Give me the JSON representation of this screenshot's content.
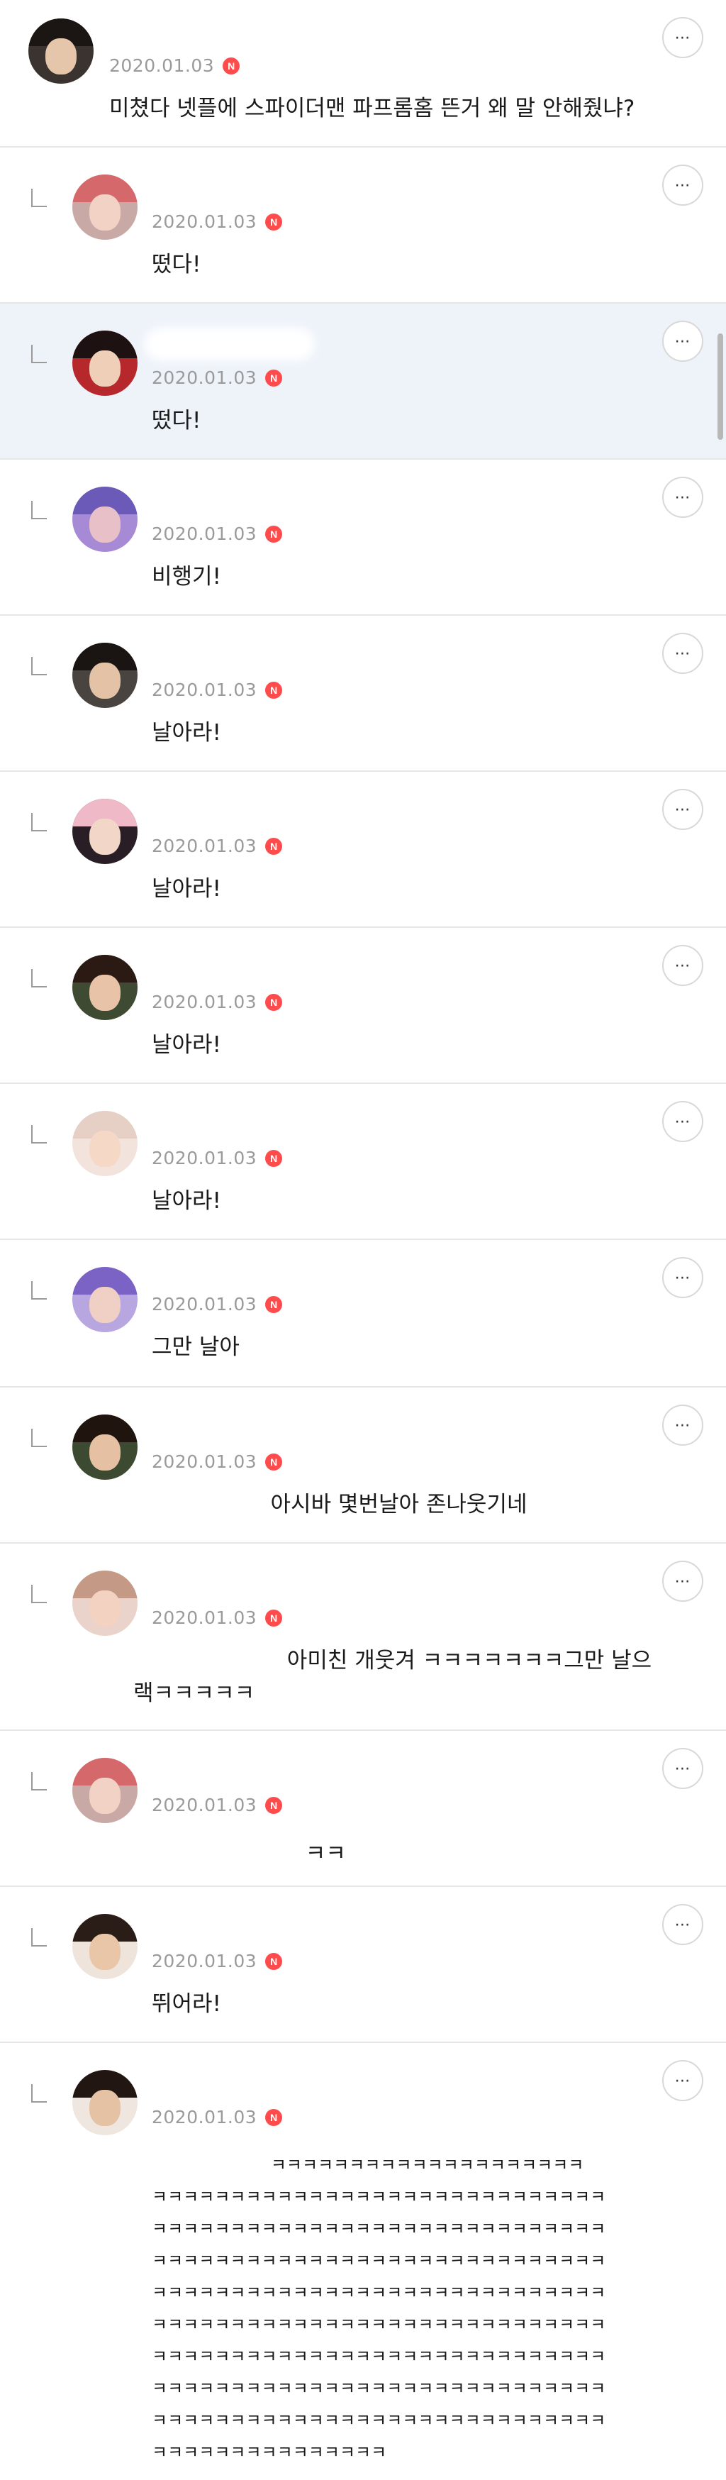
{
  "post": {
    "date": "2020.01.03",
    "badge": "N",
    "text": "미쳤다 넷플에 스파이더맨 파프롬홈 뜬거 왜 말 안해줬냐?",
    "more": "⋯"
  },
  "replies": [
    {
      "date": "2020.01.03",
      "badge": "N",
      "text": "떴다!",
      "more": "⋯"
    },
    {
      "date": "2020.01.03",
      "badge": "N",
      "text": "떴다!",
      "more": "⋯"
    },
    {
      "date": "2020.01.03",
      "badge": "N",
      "text": "비행기!",
      "more": "⋯"
    },
    {
      "date": "2020.01.03",
      "badge": "N",
      "text": "날아라!",
      "more": "⋯"
    },
    {
      "date": "2020.01.03",
      "badge": "N",
      "text": "날아라!",
      "more": "⋯"
    },
    {
      "date": "2020.01.03",
      "badge": "N",
      "text": "날아라!",
      "more": "⋯"
    },
    {
      "date": "2020.01.03",
      "badge": "N",
      "text": "날아라!",
      "more": "⋯"
    },
    {
      "date": "2020.01.03",
      "badge": "N",
      "text": "그만 날아",
      "more": "⋯"
    },
    {
      "date": "2020.01.03",
      "badge": "N",
      "text": "                 아시바 몇번날아 존나웃기네",
      "more": "⋯"
    },
    {
      "date": "2020.01.03",
      "badge": "N",
      "text": "                      아미친 개웃겨 ㅋㅋㅋㅋㅋㅋㅋ그만 날으\n랙ㅋㅋㅋㅋㅋ",
      "more": "⋯"
    },
    {
      "date": "2020.01.03",
      "badge": "N",
      "text": "                      ㅋㅋ",
      "more": "⋯"
    },
    {
      "date": "2020.01.03",
      "badge": "N",
      "text": "뛰어라!",
      "more": "⋯"
    },
    {
      "date": "2020.01.03",
      "badge": "N",
      "text": "                      ㅋㅋㅋㅋㅋㅋㅋㅋㅋㅋㅋㅋㅋㅋㅋㅋㅋㅋㅋㅋ\nㅋㅋㅋㅋㅋㅋㅋㅋㅋㅋㅋㅋㅋㅋㅋㅋㅋㅋㅋㅋㅋㅋㅋㅋㅋㅋㅋㅋㅋ\nㅋㅋㅋㅋㅋㅋㅋㅋㅋㅋㅋㅋㅋㅋㅋㅋㅋㅋㅋㅋㅋㅋㅋㅋㅋㅋㅋㅋㅋ\nㅋㅋㅋㅋㅋㅋㅋㅋㅋㅋㅋㅋㅋㅋㅋㅋㅋㅋㅋㅋㅋㅋㅋㅋㅋㅋㅋㅋㅋ\nㅋㅋㅋㅋㅋㅋㅋㅋㅋㅋㅋㅋㅋㅋㅋㅋㅋㅋㅋㅋㅋㅋㅋㅋㅋㅋㅋㅋㅋ\nㅋㅋㅋㅋㅋㅋㅋㅋㅋㅋㅋㅋㅋㅋㅋㅋㅋㅋㅋㅋㅋㅋㅋㅋㅋㅋㅋㅋㅋ\nㅋㅋㅋㅋㅋㅋㅋㅋㅋㅋㅋㅋㅋㅋㅋㅋㅋㅋㅋㅋㅋㅋㅋㅋㅋㅋㅋㅋㅋ\nㅋㅋㅋㅋㅋㅋㅋㅋㅋㅋㅋㅋㅋㅋㅋㅋㅋㅋㅋㅋㅋㅋㅋㅋㅋㅋㅋㅋㅋ\nㅋㅋㅋㅋㅋㅋㅋㅋㅋㅋㅋㅋㅋㅋㅋㅋㅋㅋㅋㅋㅋㅋㅋㅋㅋㅋㅋㅋㅋ\nㅋㅋㅋㅋㅋㅋㅋㅋㅋㅋㅋㅋㅋㅋㅋ",
      "more": "⋯"
    }
  ],
  "colors": {
    "badge": "#ff4b4b",
    "date": "#9a9a9a",
    "divider": "#e6e6e6",
    "highlight": "#eef3fa"
  },
  "icons": {
    "more": "more-icon",
    "reply": "reply-arrow-icon",
    "badge": "new-badge-icon"
  }
}
